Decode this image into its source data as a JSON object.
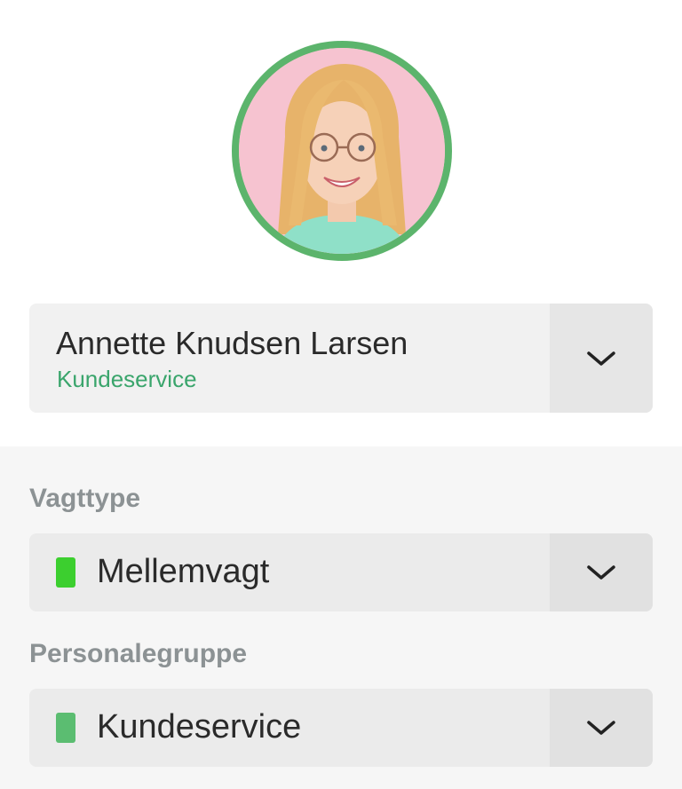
{
  "profile": {
    "avatar_icon": "user-avatar-photo",
    "avatar_ring_color": "#5cb46c"
  },
  "employee": {
    "name": "Annette Knudsen Larsen",
    "department": "Kundeservice",
    "department_color": "#3aa56c",
    "chevron_icon": "chevron-down-icon"
  },
  "shift_type": {
    "label": "Vagttype",
    "value": "Mellemvagt",
    "color": "#3ccf2f",
    "chevron_icon": "chevron-down-icon"
  },
  "staff_group": {
    "label": "Personalegruppe",
    "value": "Kundeservice",
    "color": "#5bbd71",
    "chevron_icon": "chevron-down-icon"
  }
}
